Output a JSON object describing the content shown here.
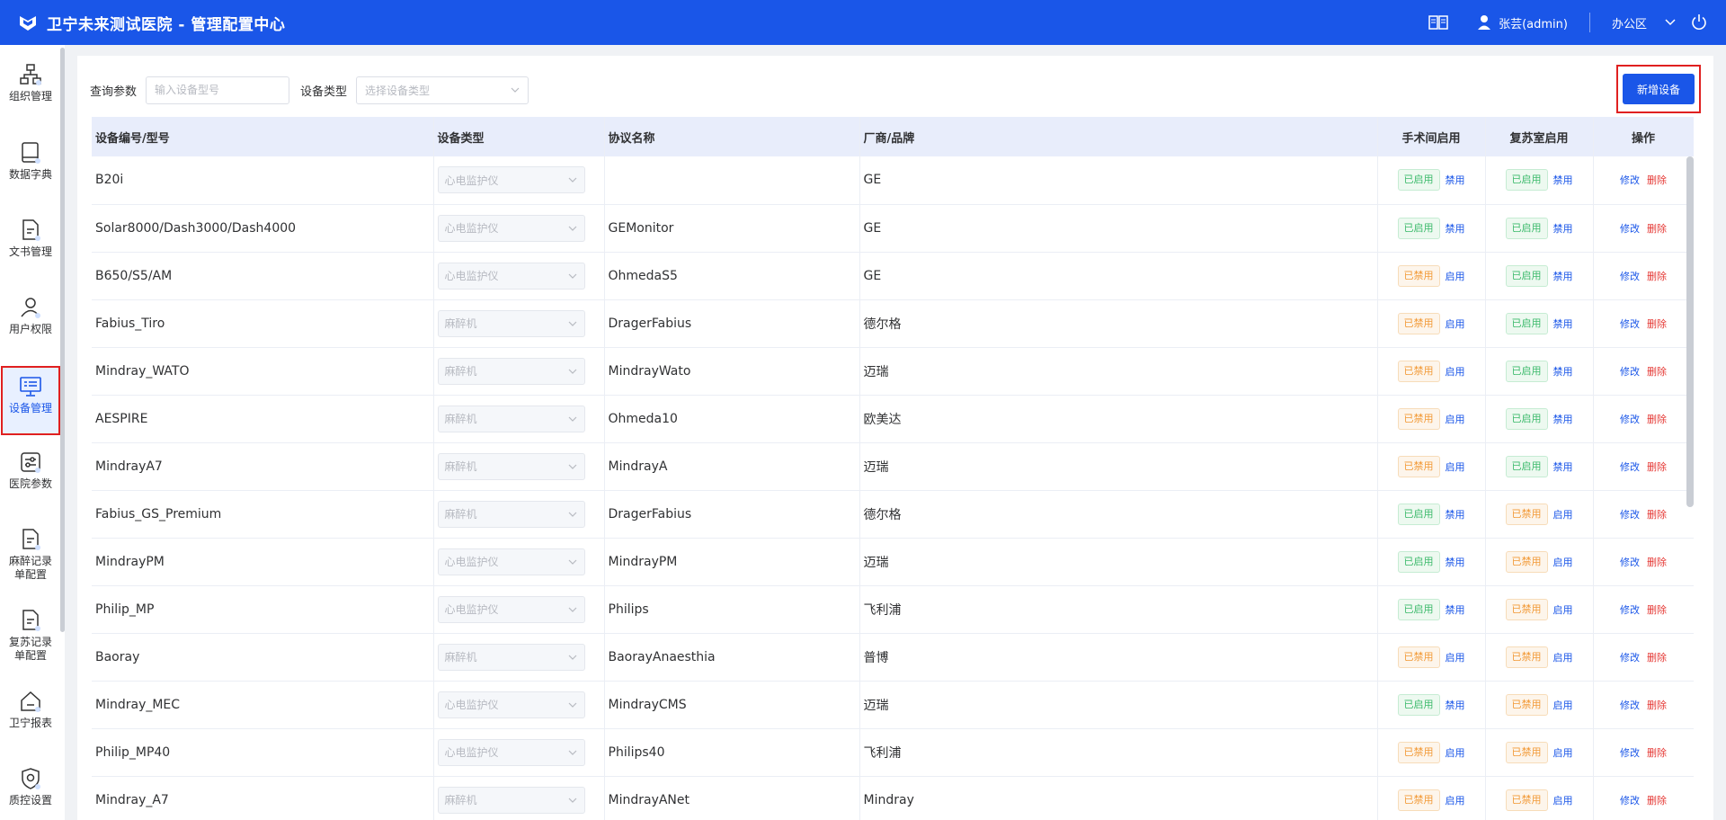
{
  "header": {
    "title": "卫宁未来测试医院 - 管理配置中心",
    "user": "张芸(admin)",
    "area": "办公区"
  },
  "sidebar": {
    "items": [
      {
        "label": "组织管理",
        "icon": "org-tree-icon"
      },
      {
        "label": "数据字典",
        "icon": "book-icon"
      },
      {
        "label": "文书管理",
        "icon": "document-icon"
      },
      {
        "label": "用户权限",
        "icon": "user-icon"
      },
      {
        "label": "设备管理",
        "icon": "monitor-icon",
        "active": true
      },
      {
        "label": "医院参数",
        "icon": "settings-panel-icon"
      },
      {
        "label": "麻醉记录\n单配置",
        "icon": "document-icon"
      },
      {
        "label": "复苏记录\n单配置",
        "icon": "document-icon"
      },
      {
        "label": "卫宁报表",
        "icon": "home-icon"
      },
      {
        "label": "质控设置",
        "icon": "shield-icon"
      }
    ]
  },
  "filter": {
    "query_label": "查询参数",
    "query_placeholder": "输入设备型号",
    "type_label": "设备类型",
    "type_placeholder": "选择设备类型"
  },
  "add_button": "新增设备",
  "table": {
    "headers": [
      "设备编号/型号",
      "设备类型",
      "协议名称",
      "厂商/品牌",
      "手术间启用",
      "复苏室启用",
      "操作"
    ],
    "labels": {
      "enabled": "已启用",
      "disabled": "已禁用",
      "disable": "禁用",
      "enable": "启用",
      "edit": "修改",
      "delete": "删除"
    },
    "rows": [
      {
        "model": "B20i",
        "type": "心电监护仪",
        "protocol": "",
        "vendor": "GE",
        "or_enabled": true,
        "rec_enabled": true
      },
      {
        "model": "Solar8000/Dash3000/Dash4000",
        "type": "心电监护仪",
        "protocol": "GEMonitor",
        "vendor": "GE",
        "or_enabled": true,
        "rec_enabled": true
      },
      {
        "model": "B650/S5/AM",
        "type": "心电监护仪",
        "protocol": "OhmedaS5",
        "vendor": "GE",
        "or_enabled": false,
        "rec_enabled": true
      },
      {
        "model": "Fabius_Tiro",
        "type": "麻醉机",
        "protocol": "DragerFabius",
        "vendor": "德尔格",
        "or_enabled": false,
        "rec_enabled": true
      },
      {
        "model": "Mindray_WATO",
        "type": "麻醉机",
        "protocol": "MindrayWato",
        "vendor": "迈瑞",
        "or_enabled": false,
        "rec_enabled": true
      },
      {
        "model": "AESPIRE",
        "type": "麻醉机",
        "protocol": "Ohmeda10",
        "vendor": "欧美达",
        "or_enabled": false,
        "rec_enabled": true
      },
      {
        "model": "MindrayA7",
        "type": "麻醉机",
        "protocol": "MindrayA",
        "vendor": "迈瑞",
        "or_enabled": false,
        "rec_enabled": true
      },
      {
        "model": "Fabius_GS_Premium",
        "type": "麻醉机",
        "protocol": "DragerFabius",
        "vendor": "德尔格",
        "or_enabled": true,
        "rec_enabled": false
      },
      {
        "model": "MindrayPM",
        "type": "心电监护仪",
        "protocol": "MindrayPM",
        "vendor": "迈瑞",
        "or_enabled": true,
        "rec_enabled": false
      },
      {
        "model": "Philip_MP",
        "type": "心电监护仪",
        "protocol": "Philips",
        "vendor": "飞利浦",
        "or_enabled": true,
        "rec_enabled": false
      },
      {
        "model": "Baoray",
        "type": "麻醉机",
        "protocol": "BaorayAnaesthia",
        "vendor": "普博",
        "or_enabled": false,
        "rec_enabled": false
      },
      {
        "model": "Mindray_MEC",
        "type": "心电监护仪",
        "protocol": "MindrayCMS",
        "vendor": "迈瑞",
        "or_enabled": true,
        "rec_enabled": false
      },
      {
        "model": "Philip_MP40",
        "type": "心电监护仪",
        "protocol": "Philips40",
        "vendor": "飞利浦",
        "or_enabled": false,
        "rec_enabled": false
      },
      {
        "model": "Mindray_A7",
        "type": "麻醉机",
        "protocol": "MindrayANet",
        "vendor": "Mindray",
        "or_enabled": false,
        "rec_enabled": false
      }
    ]
  }
}
